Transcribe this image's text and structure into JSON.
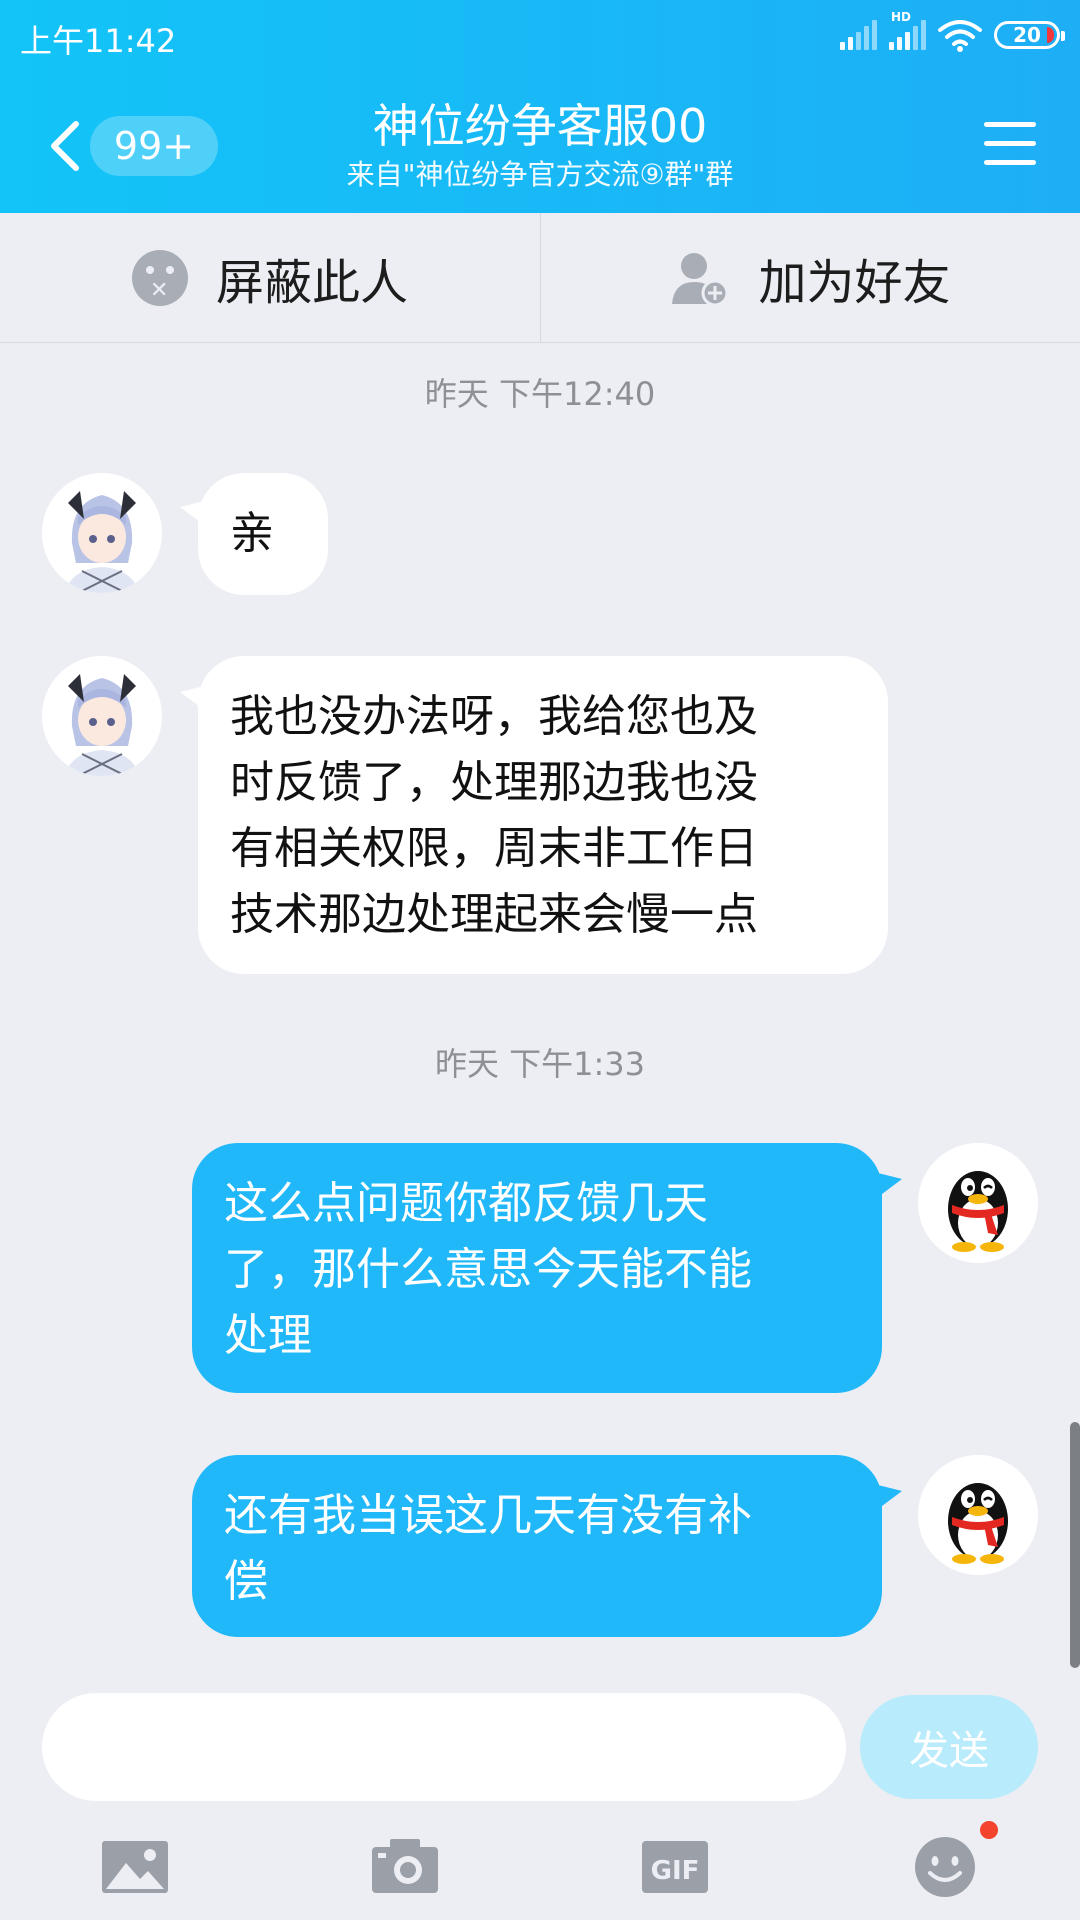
{
  "status_bar": {
    "time": "上午11:42",
    "network_label": "HD",
    "battery": "20"
  },
  "header": {
    "unread_count": "99+",
    "title": "神位纷争客服00",
    "subtitle": "来自\"神位纷争官方交流⑨群\"群"
  },
  "actions": {
    "block_label": "屏蔽此人",
    "add_friend_label": "加为好友"
  },
  "messages": [
    {
      "type": "timestamp",
      "text": "昨天 下午12:40"
    },
    {
      "type": "incoming",
      "lines": [
        "亲"
      ]
    },
    {
      "type": "incoming",
      "lines": [
        "我也没办法呀，我给您也及",
        "时反馈了，处理那边我也没",
        "有相关权限，周末非工作日",
        "技术那边处理起来会慢一点"
      ]
    },
    {
      "type": "timestamp",
      "text": "昨天 下午1:33"
    },
    {
      "type": "outgoing",
      "lines": [
        "这么点问题你都反馈几天",
        "了，那什么意思今天能不能",
        "处理"
      ]
    },
    {
      "type": "outgoing",
      "lines": [
        "还有我当误这几天有没有补",
        "偿"
      ]
    }
  ],
  "input": {
    "value": "",
    "send_label": "发送"
  },
  "toolbar": {
    "icons": [
      "image-icon",
      "camera-icon",
      "gif-icon",
      "emoji-icon"
    ],
    "gif_label": "GIF"
  },
  "colors": {
    "header": "#1eaef6",
    "outgoing_bubble": "#20b8f8",
    "incoming_bubble": "#ffffff",
    "background": "#eceef3",
    "notification_dot": "#f4442e"
  }
}
